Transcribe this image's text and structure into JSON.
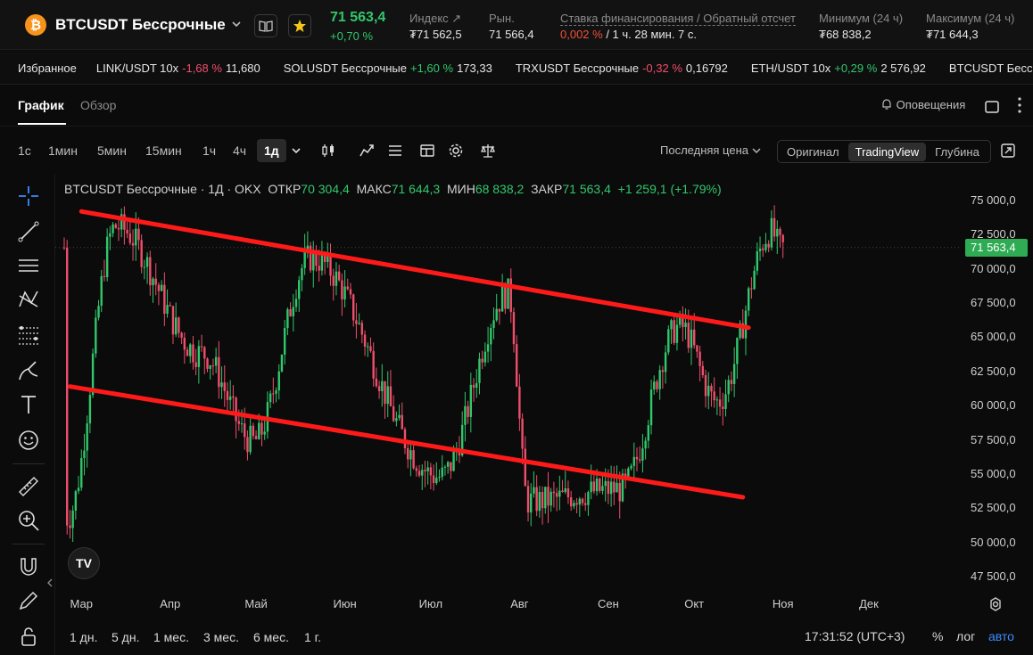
{
  "header": {
    "coin_icon": "bitcoin-icon",
    "symbol_title": "BTCUSDT Бессрочные",
    "last_price": "71 563,4",
    "change_pct": "+0,70 %",
    "index_label": "Индекс",
    "index_value": "₮71 562,5",
    "market_label": "Рын.",
    "market_value": "71 566,4",
    "funding_label": "Ставка финансирования / Обратный отсчет",
    "funding_rate": "0,002 %",
    "funding_countdown": " / 1 ч. 28 мин. 7 с.",
    "low_label": "Минимум (24 ч)",
    "low_value": "₮68 838,2",
    "high_label": "Максимум (24 ч)",
    "high_value": "₮71 644,3"
  },
  "favorites": {
    "label": "Избранное",
    "items": [
      {
        "name": "LINK/USDT 10x",
        "change": "-1,68 %",
        "price": "11,680",
        "up": false
      },
      {
        "name": "SOLUSDT Бессрочные",
        "change": "+1,60 %",
        "price": "173,33",
        "up": true
      },
      {
        "name": "TRXUSDT Бессрочные",
        "change": "-0,32 %",
        "price": "0,16792",
        "up": false
      },
      {
        "name": "ETH/USDT 10x",
        "change": "+0,29 %",
        "price": "2 576,92",
        "up": true
      },
      {
        "name": "BTCUSDT Бессрочные",
        "change": "",
        "price": "",
        "up": true
      }
    ]
  },
  "tabs": {
    "chart": "График",
    "overview": "Обзор",
    "alerts": "Оповещения"
  },
  "toolbar": {
    "timeframes": [
      "1с",
      "1мин",
      "5мин",
      "15мин",
      "1ч",
      "4ч"
    ],
    "active_timeframe": "1д",
    "price_type": "Последняя цена",
    "views": [
      "Оригинал",
      "TradingView",
      "Глубина"
    ],
    "active_view": "TradingView"
  },
  "legend": {
    "title": "BTCUSDT Бессрочные · 1Д · OKX",
    "open_label": "ОТКР",
    "open": "70 304,4",
    "high_label": "МАКС",
    "high": "71 644,3",
    "low_label": "МИН",
    "low": "68 838,2",
    "close_label": "ЗАКР",
    "close": "71 563,4",
    "change": "+1 259,1 (+1.79%)"
  },
  "chart_data": {
    "type": "candlestick",
    "y_ticks": [
      "75 000,0",
      "72 500,0",
      "70 000,0",
      "67 500,0",
      "65 000,0",
      "62 500,0",
      "60 000,0",
      "57 500,0",
      "55 000,0",
      "52 500,0",
      "50 000,0",
      "47 500,0"
    ],
    "x_ticks": [
      "Мар",
      "Апр",
      "Май",
      "Июн",
      "Июл",
      "Авг",
      "Сен",
      "Окт",
      "Ноя",
      "Дек"
    ],
    "ylim": [
      47500,
      75000
    ],
    "current_price": 71563.4,
    "current_price_label": "71 563,4",
    "colors": {
      "up": "#31c76c",
      "down": "#ef4e6b",
      "trendline": "#ff1a1a"
    },
    "trend_lines": [
      {
        "from": [
          "2024-03-01",
          74200
        ],
        "to": [
          "2024-10-20",
          65700
        ]
      },
      {
        "from": [
          "2024-02-26",
          61400
        ],
        "to": [
          "2024-10-18",
          53300
        ]
      }
    ],
    "key_points": [
      {
        "date": "2024-02-26",
        "close": 51800
      },
      {
        "date": "2024-03-14",
        "close": 73100
      },
      {
        "date": "2024-04-13",
        "close": 63800
      },
      {
        "date": "2024-05-01",
        "close": 57400
      },
      {
        "date": "2024-05-21",
        "close": 70800
      },
      {
        "date": "2024-07-05",
        "close": 54800
      },
      {
        "date": "2024-07-29",
        "close": 68200
      },
      {
        "date": "2024-08-05",
        "close": 53000
      },
      {
        "date": "2024-09-06",
        "close": 53900
      },
      {
        "date": "2024-09-27",
        "close": 65800
      },
      {
        "date": "2024-10-10",
        "close": 60300
      },
      {
        "date": "2024-10-29",
        "close": 72700
      },
      {
        "date": "2024-11-01",
        "close": 71563
      }
    ]
  },
  "bottom": {
    "ranges": [
      "1 дн.",
      "5 дн.",
      "1 мес.",
      "3 мес.",
      "6 мес.",
      "1 г."
    ],
    "clock": "17:31:52 (UTC+3)",
    "percent": "%",
    "log": "лог",
    "auto": "авто"
  },
  "tv_logo": "TV"
}
